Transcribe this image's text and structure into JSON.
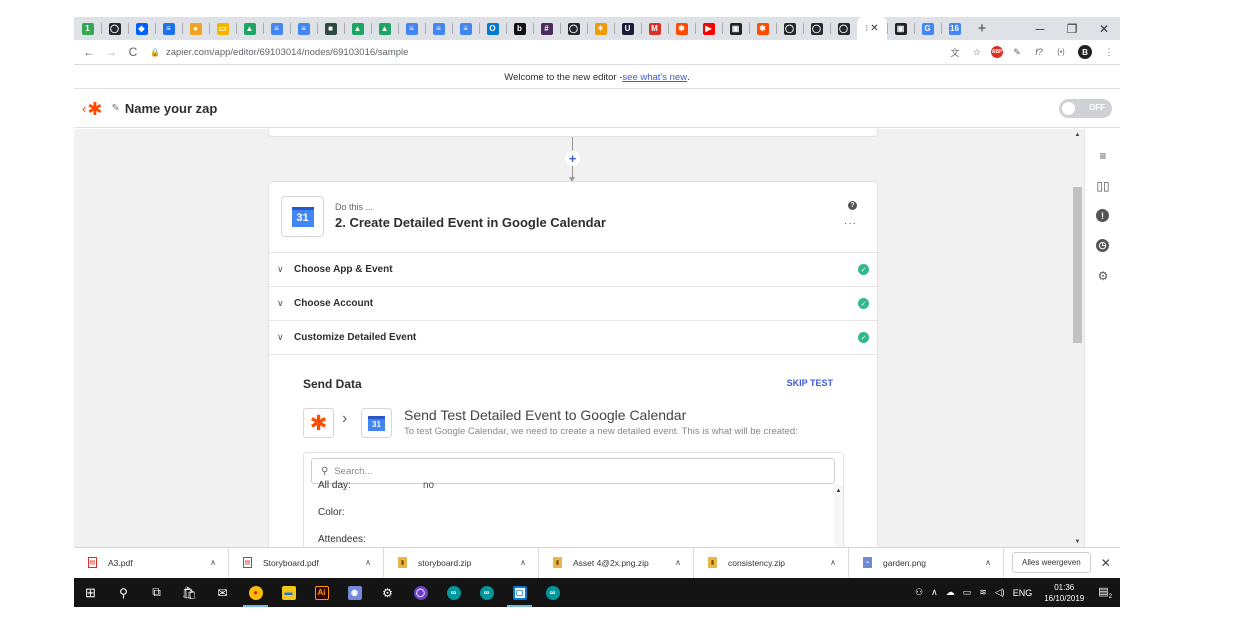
{
  "browser": {
    "tabs": [
      {
        "icon": "green-circle-icon",
        "color": "#34a853",
        "glyph": "1"
      },
      {
        "icon": "github-icon",
        "color": "#24292e",
        "glyph": "◯"
      },
      {
        "icon": "dropbox-icon",
        "color": "#0061ff",
        "glyph": "◆"
      },
      {
        "icon": "stack-icon",
        "color": "#1a73e8",
        "glyph": "≡"
      },
      {
        "icon": "orange-badge-icon",
        "color": "#f4a020",
        "glyph": "●"
      },
      {
        "icon": "slides-icon",
        "color": "#f4b400",
        "glyph": "▭"
      },
      {
        "icon": "drive-icon",
        "color": "#1fa463",
        "glyph": "▲"
      },
      {
        "icon": "docs-icon",
        "color": "#4285f4",
        "glyph": "≡"
      },
      {
        "icon": "docs-icon",
        "color": "#4285f4",
        "glyph": "≡"
      },
      {
        "icon": "dark-square-icon",
        "color": "#2d4a3e",
        "glyph": "■"
      },
      {
        "icon": "drive-icon",
        "color": "#1fa463",
        "glyph": "▲"
      },
      {
        "icon": "drive-icon",
        "color": "#1fa463",
        "glyph": "▲"
      },
      {
        "icon": "docs-icon",
        "color": "#4285f4",
        "glyph": "≡"
      },
      {
        "icon": "docs-icon",
        "color": "#4285f4",
        "glyph": "≡"
      },
      {
        "icon": "docs-icon",
        "color": "#4285f4",
        "glyph": "≡"
      },
      {
        "icon": "outlook-icon",
        "color": "#0078d4",
        "glyph": "O"
      },
      {
        "icon": "b-icon",
        "color": "#111111",
        "glyph": "b"
      },
      {
        "icon": "grid-icon",
        "color": "#4b2a5e",
        "glyph": "#"
      },
      {
        "icon": "github-icon",
        "color": "#24292e",
        "glyph": "◯"
      },
      {
        "icon": "orange-star-icon",
        "color": "#f29900",
        "glyph": "✶"
      },
      {
        "icon": "u-icon",
        "color": "#1b1b3a",
        "glyph": "U"
      },
      {
        "icon": "gmail-icon",
        "color": "#d93025",
        "glyph": "M"
      },
      {
        "icon": "zapier-icon",
        "color": "#ff4a00",
        "glyph": "✱"
      },
      {
        "icon": "youtube-icon",
        "color": "#ff0000",
        "glyph": "▶"
      },
      {
        "icon": "dark-box-icon",
        "color": "#222222",
        "glyph": "▣"
      },
      {
        "icon": "zapier-icon",
        "color": "#ff4a00",
        "glyph": "✱"
      },
      {
        "icon": "github-icon",
        "color": "#24292e",
        "glyph": "◯"
      },
      {
        "icon": "github-icon",
        "color": "#24292e",
        "glyph": "◯"
      },
      {
        "icon": "github-icon",
        "color": "#24292e",
        "glyph": "◯"
      },
      {
        "icon": "active-tab-icon",
        "color": "#ffffff",
        "glyph": "",
        "active": true
      },
      {
        "icon": "dark-box-icon",
        "color": "#222222",
        "glyph": "▣"
      },
      {
        "icon": "google-icon",
        "color": "#4285f4",
        "glyph": "G"
      },
      {
        "icon": "calendar-icon",
        "color": "#4285f4",
        "glyph": "16"
      }
    ],
    "url": "zapier.com/app/editor/69103014/nodes/69103016/sample"
  },
  "banner": {
    "text": "Welcome to the new editor - ",
    "link": "see what's new",
    "suffix": "."
  },
  "editor": {
    "zap_name": "Name your zap",
    "toggle_label": "OFF"
  },
  "step": {
    "subtitle": "Do this ...",
    "title": "2. Create Detailed Event in Google Calendar",
    "calendar_icon_text": "31",
    "sections": [
      {
        "label": "Choose App & Event"
      },
      {
        "label": "Choose Account"
      },
      {
        "label": "Customize Detailed Event"
      }
    ]
  },
  "send_data": {
    "title": "Send Data",
    "skip": "SKIP TEST",
    "heading": "Send Test Detailed Event to Google Calendar",
    "subtext": "To test Google Calendar, we need to create a new detailed event. This is what will be created:",
    "search_placeholder": "Search...",
    "fields": [
      {
        "label": "All day:",
        "value": "no"
      },
      {
        "label": "Color:",
        "value": ""
      },
      {
        "label": "Attendees:",
        "value": ""
      }
    ]
  },
  "downloads": {
    "items": [
      {
        "name": "A3.pdf",
        "type": "pdf"
      },
      {
        "name": "Storyboard.pdf",
        "type": "pdf"
      },
      {
        "name": "storyboard.zip",
        "type": "zip"
      },
      {
        "name": "Asset 4@2x.png.zip",
        "type": "zip"
      },
      {
        "name": "consistency.zip",
        "type": "zip"
      },
      {
        "name": "garden.png",
        "type": "png"
      }
    ],
    "show_all": "Alles weergeven"
  },
  "taskbar": {
    "language": "ENG",
    "time": "01:36",
    "date": "16/10/2019",
    "notifications": "2"
  }
}
